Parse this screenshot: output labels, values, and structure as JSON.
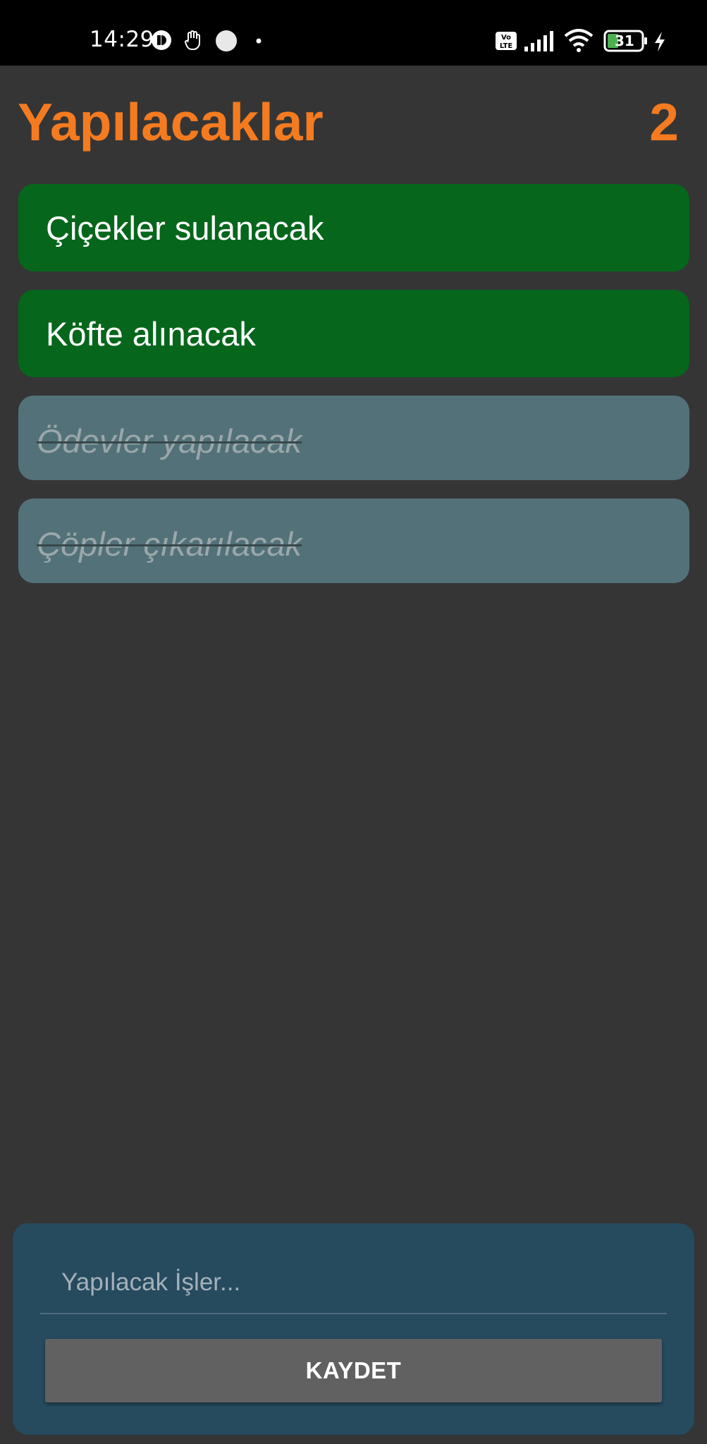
{
  "status_bar": {
    "time": "14:29",
    "battery_level": "31",
    "icons": [
      "notification-app-icon",
      "hand-icon",
      "circle-icon",
      "dot-icon",
      "volte-icon",
      "signal-icon",
      "wifi-icon",
      "battery-icon",
      "charging-icon"
    ]
  },
  "header": {
    "title": "Yapılacaklar",
    "pending_count": "2"
  },
  "tasks": [
    {
      "label": "Çiçekler sulanacak",
      "done": false
    },
    {
      "label": "Köfte alınacak",
      "done": false
    },
    {
      "label": "Ödevler yapılacak",
      "done": true
    },
    {
      "label": "Çöpler çıkarılacak",
      "done": true
    }
  ],
  "input_panel": {
    "placeholder": "Yapılacak İşler...",
    "value": "",
    "save_label": "KAYDET"
  },
  "colors": {
    "accent": "#f47b20",
    "active_task": "#06661b",
    "done_task": "#537178",
    "panel": "#264a5e",
    "background": "#353535"
  }
}
